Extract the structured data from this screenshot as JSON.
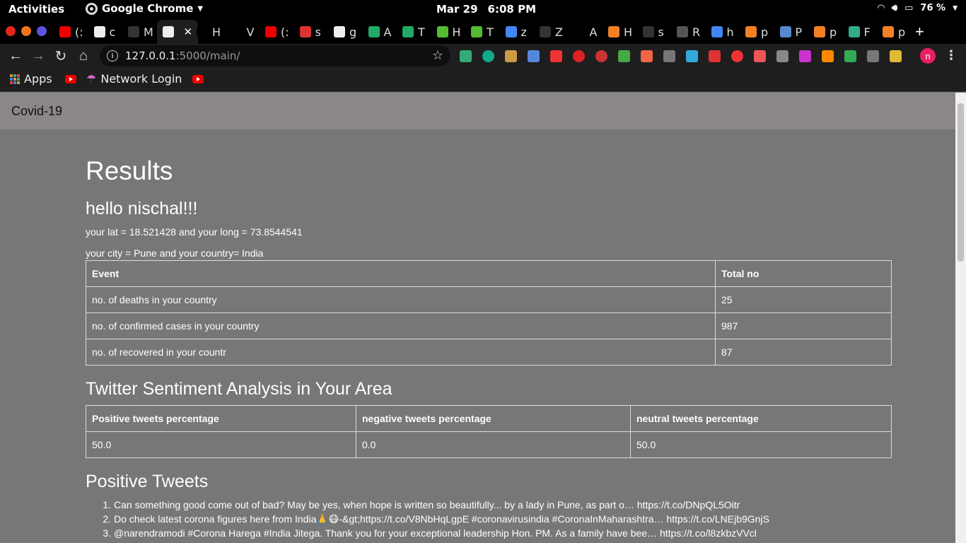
{
  "system": {
    "activities": "Activities",
    "app_name": "Google Chrome",
    "date": "Mar 29",
    "time": "6:08 PM",
    "battery": "76 %"
  },
  "tabs": [
    {
      "label": "(:",
      "icon": "youtube-icon",
      "color": "#e00"
    },
    {
      "label": "c",
      "icon": "hexagon-icon",
      "color": "#eee"
    },
    {
      "label": "M",
      "icon": "github-icon",
      "color": "#333"
    },
    {
      "label": "",
      "icon": "globe-icon",
      "color": "#eee",
      "active": true
    },
    {
      "label": "H",
      "icon": "medium-icon",
      "color": "#000"
    },
    {
      "label": "V",
      "icon": "dev-icon",
      "color": "#000"
    },
    {
      "label": "(:",
      "icon": "youtube-icon",
      "color": "#e00"
    },
    {
      "label": "s",
      "icon": "gmail-icon",
      "color": "#d33"
    },
    {
      "label": "g",
      "icon": "hexagon-icon",
      "color": "#eee"
    },
    {
      "label": "A",
      "icon": "card-icon",
      "color": "#2a6"
    },
    {
      "label": "T",
      "icon": "gfg-icon",
      "color": "#2a6"
    },
    {
      "label": "H",
      "icon": "chart-icon",
      "color": "#5b3"
    },
    {
      "label": "T",
      "icon": "chart-icon",
      "color": "#5b3"
    },
    {
      "label": "z",
      "icon": "google-icon",
      "color": "#4285f4"
    },
    {
      "label": "Z",
      "icon": "github-icon",
      "color": "#333"
    },
    {
      "label": "A",
      "icon": "medium-icon",
      "color": "#000"
    },
    {
      "label": "H",
      "icon": "stackoverflow-icon",
      "color": "#f48024"
    },
    {
      "label": "s",
      "icon": "github-icon",
      "color": "#333"
    },
    {
      "label": "R",
      "icon": "react-icon",
      "color": "#555"
    },
    {
      "label": "h",
      "icon": "google-icon",
      "color": "#4285f4"
    },
    {
      "label": "p",
      "icon": "stackoverflow-icon",
      "color": "#f48024"
    },
    {
      "label": "P",
      "icon": "gear-icon",
      "color": "#58c"
    },
    {
      "label": "p",
      "icon": "stackoverflow-icon",
      "color": "#f48024"
    },
    {
      "label": "F",
      "icon": "diamond-icon",
      "color": "#3a8"
    },
    {
      "label": "p",
      "icon": "stackoverflow-icon",
      "color": "#f48024"
    }
  ],
  "url": {
    "host": "127.0.0.1",
    "path": ":5000/main/"
  },
  "bookmarks": {
    "apps": "Apps",
    "network_login": "Network Login"
  },
  "avatar_letter": "n",
  "page": {
    "brand": "Covid-19",
    "title": "Results",
    "greeting": "hello nischal!!!",
    "latlong": "your lat = 18.521428 and your long = 73.8544541",
    "location": "your city = Pune and your country= India",
    "stats_table": {
      "headers": [
        "Event",
        "Total no"
      ],
      "rows": [
        [
          "no. of deaths in your country",
          "25"
        ],
        [
          "no. of confirmed cases in your country",
          "987"
        ],
        [
          "no. of recovered in your countr",
          "87"
        ]
      ]
    },
    "sentiment_title": "Twitter Sentiment Analysis in Your Area",
    "sentiment_table": {
      "headers": [
        "Positive tweets percentage",
        "negative tweets percentage",
        "neutral tweets percentage"
      ],
      "rows": [
        [
          "50.0",
          "0.0",
          "50.0"
        ]
      ]
    },
    "positive_title": "Positive Tweets",
    "positive_tweets": [
      "Can something good come out of bad? May be yes, when hope is written so beautifully... by a lady in Pune, as part o… https://t.co/DNpQL5Oitr",
      "Do check latest corona figures here from India🙏😷-&gt;https://t.co/V8NbHqLgpE #coronavirusindia #CoronaInMaharashtra… https://t.co/LNEjb9GnjS",
      "@narendramodi #Corona Harega #India Jitega. Thank you for your exceptional leadership Hon. PM. As a family have bee… https://t.co/l8zkbzVVcl"
    ]
  }
}
